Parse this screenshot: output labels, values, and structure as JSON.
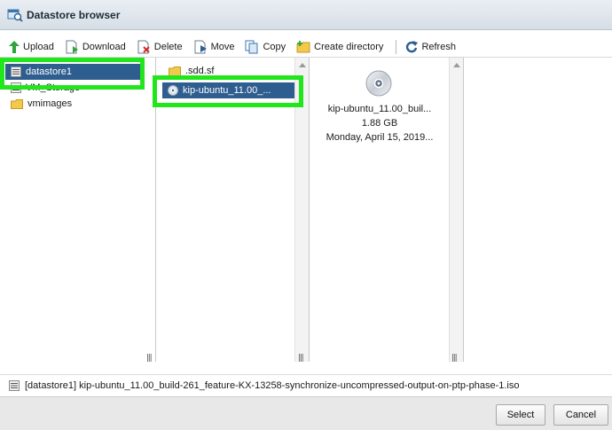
{
  "window": {
    "title": "Datastore browser"
  },
  "toolbar": {
    "upload": "Upload",
    "download": "Download",
    "delete": "Delete",
    "move": "Move",
    "copy": "Copy",
    "create_directory": "Create directory",
    "refresh": "Refresh"
  },
  "datastores": [
    {
      "name": "datastore1",
      "icon": "datastore-icon",
      "selected": true
    },
    {
      "name": "VM_Storage",
      "icon": "datastore-icon",
      "selected": false
    },
    {
      "name": "vmimages",
      "icon": "folder-icon",
      "selected": false
    }
  ],
  "files": [
    {
      "name": ".sdd.sf",
      "icon": "folder-icon",
      "selected": false
    },
    {
      "name": "kip-ubuntu_11.00_...",
      "icon": "disc-icon",
      "selected": true
    }
  ],
  "details": {
    "icon": "disc-icon",
    "name": "kip-ubuntu_11.00_buil...",
    "size": "1.88 GB",
    "date": "Monday, April 15, 2019..."
  },
  "status": {
    "path": "[datastore1] kip-ubuntu_11.00_build-261_feature-KX-13258-synchronize-uncompressed-output-on-ptp-phase-1.iso"
  },
  "footer": {
    "select_label": "Select",
    "cancel_label": "Cancel"
  },
  "colors": {
    "selection": "#2e5d8f",
    "highlight": "#22e61c"
  }
}
